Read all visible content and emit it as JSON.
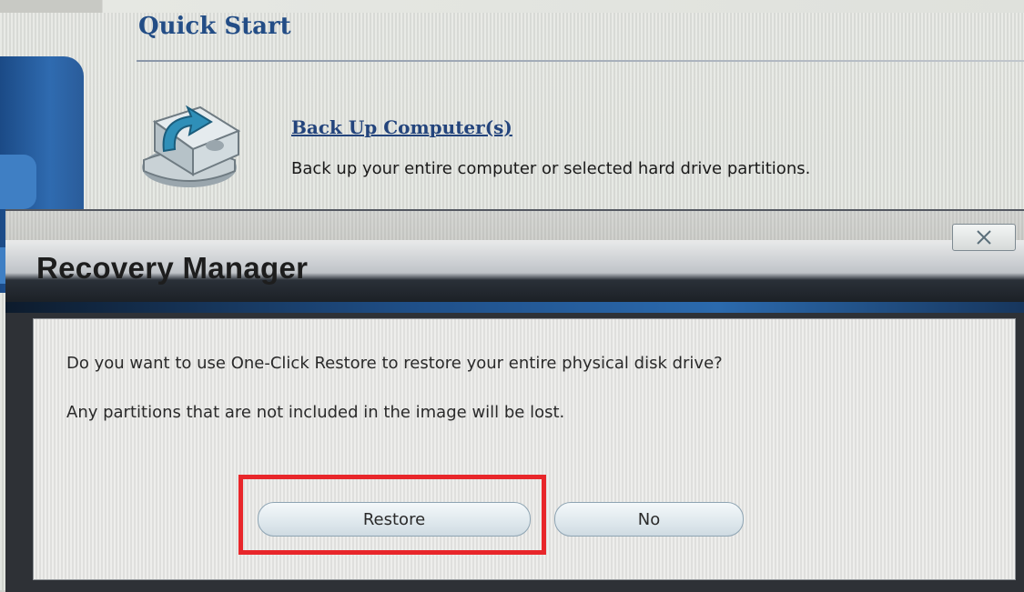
{
  "background_window": {
    "section_title": "Quick Start",
    "backup_item": {
      "link_label": "Back Up Computer(s)",
      "description": "Back up your entire computer or selected hard drive partitions.",
      "icon": "backup-icon"
    }
  },
  "dialog": {
    "title": "Recovery Manager",
    "close_icon": "close-icon",
    "message_line1": "Do you want to use One-Click Restore to restore your entire physical disk drive?",
    "message_line2": "Any partitions that are not included in the image will be lost.",
    "buttons": {
      "restore_label": "Restore",
      "no_label": "No"
    }
  },
  "annotation": {
    "highlight_color": "#e8262a",
    "highlighted_target": "restore-button"
  }
}
